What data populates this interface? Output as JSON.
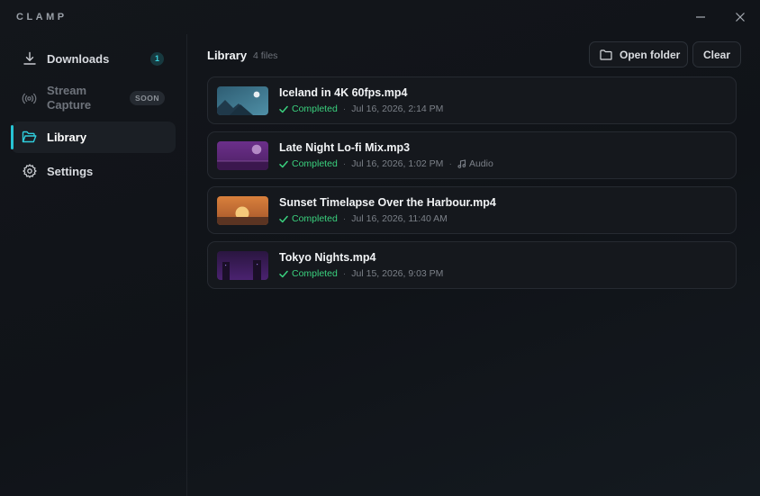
{
  "app": {
    "brand": "CLAMP"
  },
  "sidebar": {
    "items": [
      {
        "label": "Downloads",
        "badge": "1"
      },
      {
        "label": "Stream\nCapture",
        "badge": "SOON"
      },
      {
        "label": "Library"
      },
      {
        "label": "Settings"
      }
    ]
  },
  "library": {
    "title": "Library",
    "count": "4 files",
    "open_folder_label": "Open folder",
    "clear_label": "Clear",
    "files": [
      {
        "name": "Iceland in 4K 60fps.mp4",
        "status": "Completed",
        "date": "Jul 16, 2026, 2:14 PM"
      },
      {
        "name": "Late Night Lo-fi Mix.mp3",
        "status": "Completed",
        "date": "Jul 16, 2026, 1:02 PM",
        "type": "Audio"
      },
      {
        "name": "Sunset Timelapse Over the Harbour.mp4",
        "status": "Completed",
        "date": "Jul 16, 2026, 11:40 AM"
      },
      {
        "name": "Tokyo Nights.mp4",
        "status": "Completed",
        "date": "Jul 15, 2026, 9:03 PM"
      }
    ],
    "separator": "·"
  },
  "colors": {
    "accent": "#27c4d4",
    "success": "#3ad17e",
    "background": "#111419",
    "card": "#15181d"
  },
  "icons": {
    "window": [
      "minimize-icon",
      "close-icon"
    ],
    "sidebar": [
      "download-icon",
      "broadcast-icon",
      "folder-open-icon",
      "gear-icon"
    ],
    "toolbar": [
      "folder-icon"
    ],
    "status": "check-icon",
    "audio": "music-note-icon"
  }
}
